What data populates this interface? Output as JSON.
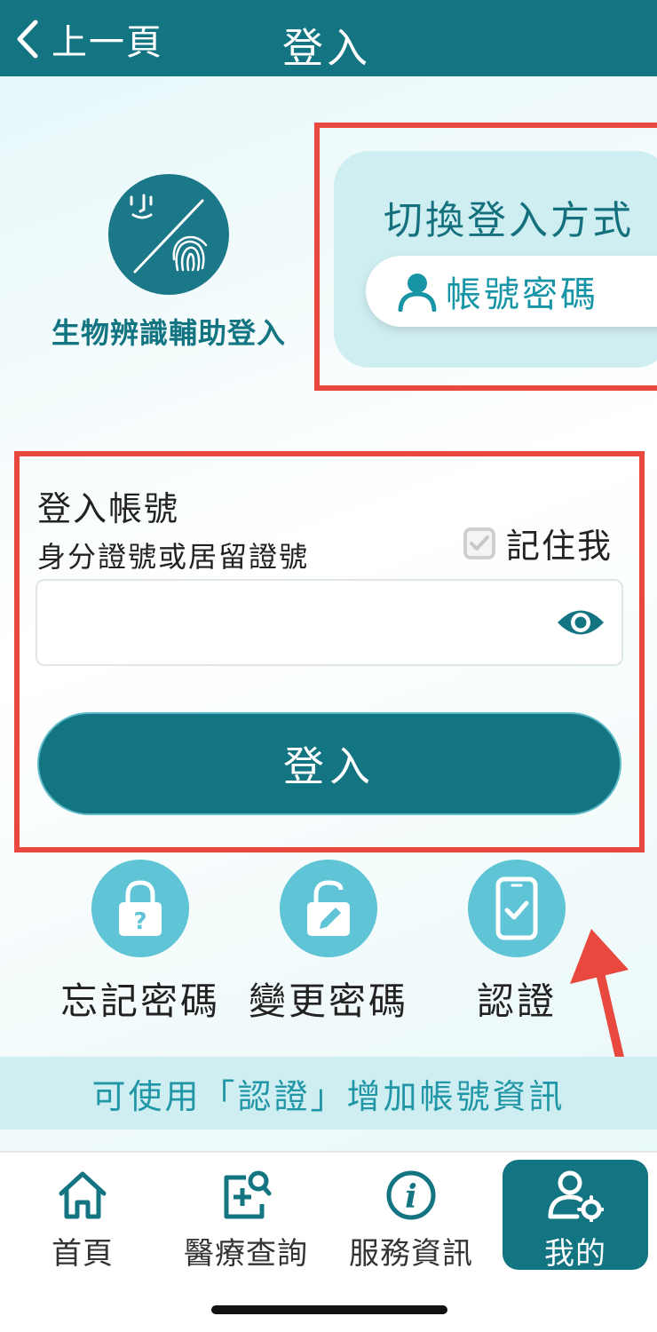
{
  "header": {
    "back_label": "上一頁",
    "title": "登入"
  },
  "biometric": {
    "label": "生物辨識輔助登入",
    "icon": "face-fingerprint-icon"
  },
  "switch": {
    "title": "切換登入方式",
    "account_label": "帳號密碼",
    "icon": "user-icon"
  },
  "login": {
    "account_title": "登入帳號",
    "account_hint": "身分證號或居留證號",
    "remember_label": "記住我",
    "remember_checked": true,
    "input_value": "",
    "button_label": "登入"
  },
  "actions": [
    {
      "label": "忘記密碼",
      "icon": "lock-question-icon"
    },
    {
      "label": "變更密碼",
      "icon": "lock-edit-icon"
    },
    {
      "label": "認證",
      "icon": "phone-check-icon"
    }
  ],
  "tip": "可使用「認證」增加帳號資訊",
  "tabs": [
    {
      "label": "首頁",
      "icon": "home-icon"
    },
    {
      "label": "醫療查詢",
      "icon": "medical-search-icon"
    },
    {
      "label": "服務資訊",
      "icon": "info-icon"
    },
    {
      "label": "我的",
      "icon": "user-settings-icon"
    }
  ],
  "colors": {
    "primary": "#137482",
    "accent": "#5ec4d6",
    "highlight_border": "#e8483e"
  }
}
